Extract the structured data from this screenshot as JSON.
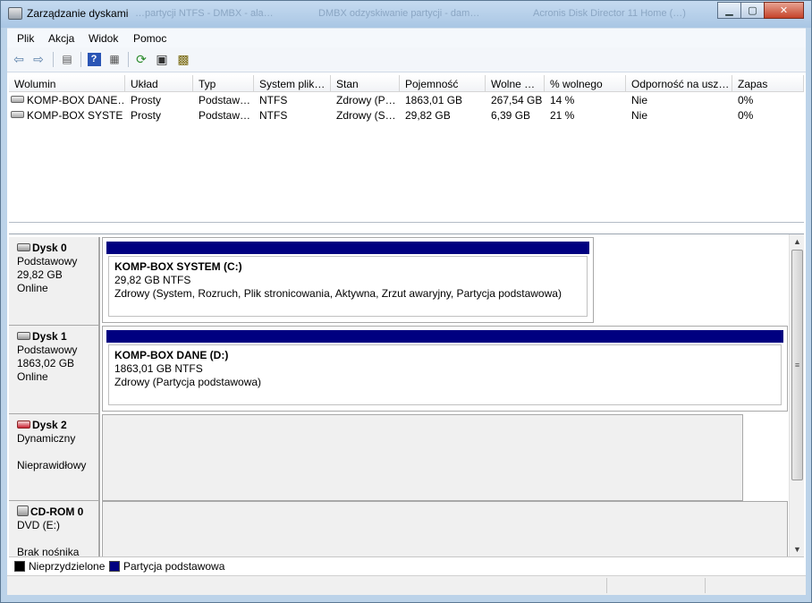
{
  "window": {
    "title": "Zarządzanie dyskami",
    "ghost_titles": [
      "…partycji NTFS - DMBX - ala…",
      "DMBX odzyskiwanie partycji - dam…",
      "Acronis Disk Director 11 Home (…)"
    ]
  },
  "menu": [
    "Plik",
    "Akcja",
    "Widok",
    "Pomoc"
  ],
  "toolbar_icons": [
    "back-arrow-icon",
    "forward-arrow-icon",
    "console-tree-icon",
    "help-icon",
    "properties-view-icon",
    "refresh-icon",
    "properties-icon",
    "settings-icon"
  ],
  "volume_list": {
    "columns": [
      "Wolumin",
      "Układ",
      "Typ",
      "System plik…",
      "Stan",
      "Pojemność",
      "Wolne …",
      "% wolnego",
      "Odporność na usz…",
      "Zapas"
    ],
    "rows": [
      [
        "KOMP-BOX DANE…",
        "Prosty",
        "Podstaw…",
        "NTFS",
        "Zdrowy (P…",
        "1863,01 GB",
        "267,54 GB",
        "14 %",
        "Nie",
        "0%"
      ],
      [
        "KOMP-BOX SYSTE…",
        "Prosty",
        "Podstaw…",
        "NTFS",
        "Zdrowy (S…",
        "29,82 GB",
        "6,39 GB",
        "21 %",
        "Nie",
        "0%"
      ]
    ]
  },
  "disks": [
    {
      "name": "Dysk 0",
      "type": "Podstawowy",
      "size": "29,82 GB",
      "status": "Online",
      "partition": {
        "name": "KOMP-BOX SYSTEM  (C:)",
        "fs": "29,82 GB NTFS",
        "health": "Zdrowy (System, Rozruch, Plik stronicowania, Aktywna, Zrzut awaryjny, Partycja podstawowa)"
      }
    },
    {
      "name": "Dysk 1",
      "type": "Podstawowy",
      "size": "1863,02 GB",
      "status": "Online",
      "partition": {
        "name": "KOMP-BOX DANE  (D:)",
        "fs": "1863,01 GB NTFS",
        "health": "Zdrowy (Partycja podstawowa)"
      }
    },
    {
      "name": "Dysk 2",
      "type": "Dynamiczny",
      "status": "Nieprawidłowy"
    },
    {
      "name": "CD-ROM 0",
      "type": "DVD (E:)",
      "status": "Brak nośnika"
    }
  ],
  "legend": [
    {
      "label": "Nieprzydzielone",
      "color": "#000000"
    },
    {
      "label": "Partycja podstawowa",
      "color": "#000080"
    }
  ]
}
